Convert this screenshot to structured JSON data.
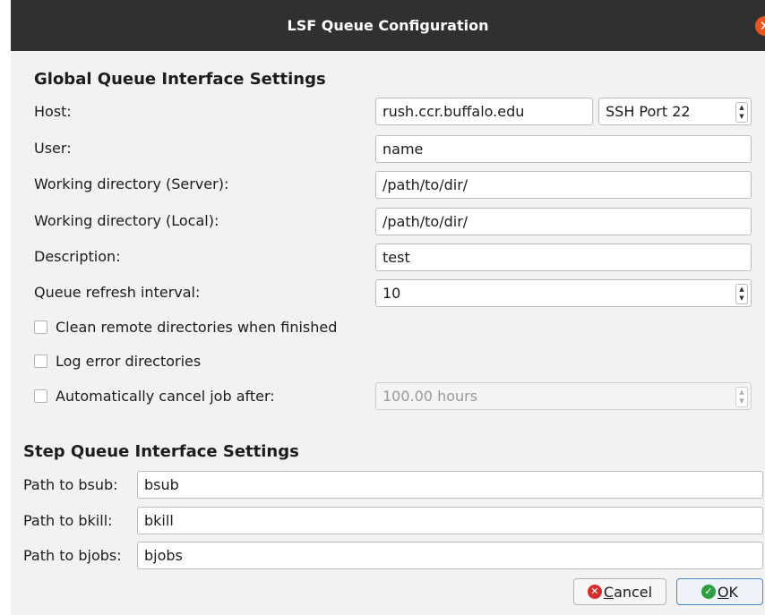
{
  "window": {
    "title": "LSF Queue Configuration",
    "close_icon": "close-icon"
  },
  "global": {
    "title": "Global Queue Interface Settings",
    "host_label": "Host:",
    "host_value": "rush.ccr.buffalo.edu",
    "ssh_port_value": "SSH Port 22",
    "user_label": "User:",
    "user_value": "name",
    "workdir_server_label": "Working directory (Server):",
    "workdir_server_value": "/path/to/dir/",
    "workdir_local_label": "Working directory (Local):",
    "workdir_local_value": "/path/to/dir/",
    "description_label": "Description:",
    "description_value": "test",
    "refresh_label": "Queue refresh interval:",
    "refresh_value": "10",
    "clean_remote_label": "Clean remote directories when finished",
    "clean_remote_checked": false,
    "log_error_label": "Log error directories",
    "log_error_checked": false,
    "auto_cancel_label": "Automatically cancel job after:",
    "auto_cancel_checked": false,
    "auto_cancel_value": "100.00 hours"
  },
  "step": {
    "title": "Step Queue Interface Settings",
    "bsub_label": "Path to bsub:",
    "bsub_value": "bsub",
    "bkill_label": "Path to bkill:",
    "bkill_value": "bkill",
    "bjobs_label": "Path to bjobs:",
    "bjobs_value": "bjobs"
  },
  "buttons": {
    "cancel_first": "C",
    "cancel_rest": "ancel",
    "ok_first": "O",
    "ok_rest": "K"
  },
  "colors": {
    "titlebar": "#303030",
    "close": "#e95420",
    "cancel_icon": "#d32f2f",
    "ok_icon": "#2e9e41"
  }
}
